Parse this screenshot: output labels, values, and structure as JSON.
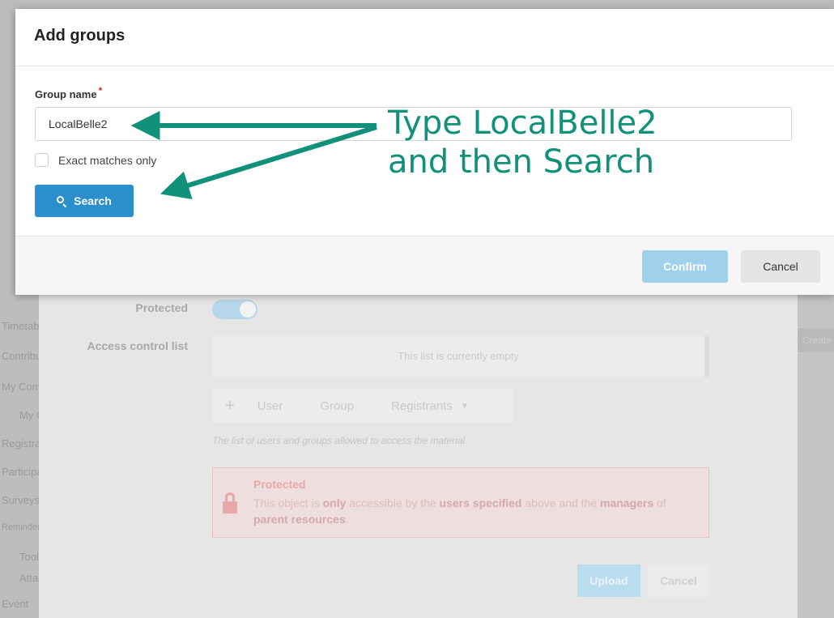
{
  "modal": {
    "title": "Add groups",
    "field_label": "Group name",
    "required_marker": "*",
    "group_input_value": "LocalBelle2",
    "exact_matches_label": "Exact matches only",
    "exact_matches_checked": false,
    "search_label": "Search",
    "confirm_label": "Confirm",
    "cancel_label": "Cancel"
  },
  "annotation": {
    "line1": "Type LocalBelle2",
    "line2": "and then Search",
    "color": "#11907a"
  },
  "background": {
    "nav_items": [
      "Timetable",
      "Contributions",
      "My Conference",
      "My Contributions",
      "Registration",
      "Participant List",
      "Surveys",
      "Reminders",
      "Tools",
      "Attachments",
      "Event"
    ],
    "protected_label": "Protected",
    "acl_label": "Access control list",
    "acl_empty": "This list is currently empty",
    "acl_bar": [
      "+",
      "User",
      "Group",
      "Registrants"
    ],
    "acl_help": "The list of users and groups allowed to access the material",
    "protected_box_title": "Protected",
    "protected_box_pre": "This object is ",
    "protected_box_only": "only",
    "protected_box_mid": " accessible by the ",
    "protected_box_users": "users specified",
    "protected_box_post": " above and the ",
    "protected_box_managers": "managers",
    "protected_box_of": " of ",
    "protected_box_parents": "parent resources",
    "protected_box_end": ".",
    "upload_label": "Upload",
    "cancel_label": "Cancel",
    "right_button_label": "Create Page"
  }
}
